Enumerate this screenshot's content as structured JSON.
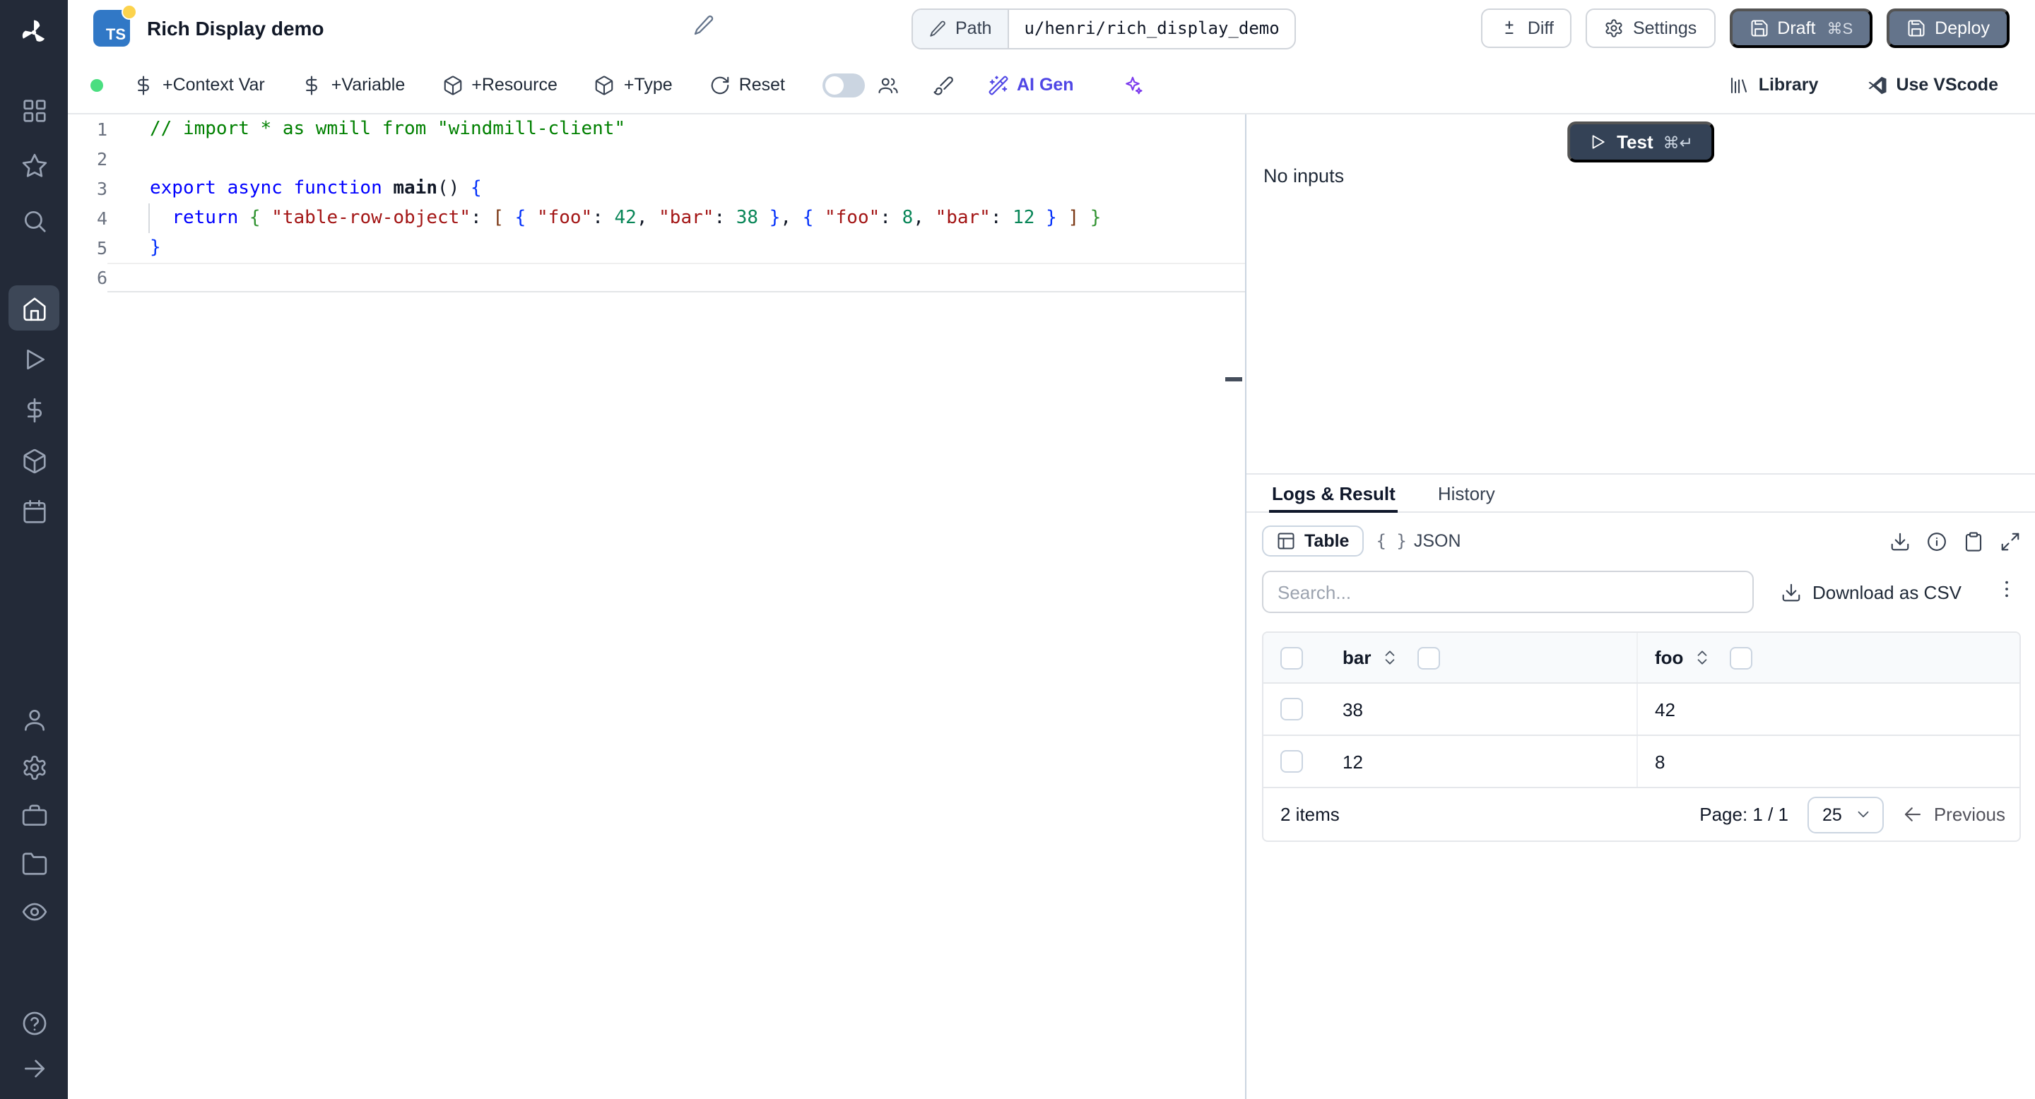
{
  "colors": {
    "sidebar_bg": "#232a38",
    "ts_blue": "#3178c6",
    "status_dot_green": "#4ade80",
    "ai_accent": "#4f46e5",
    "slate_button": "#64748b",
    "test_button": "#344256"
  },
  "sidebar": {
    "top": [
      {
        "name": "apps",
        "icon": "grid"
      },
      {
        "name": "favorites",
        "icon": "star"
      },
      {
        "name": "search",
        "icon": "search"
      }
    ],
    "nav": [
      {
        "name": "home",
        "icon": "home",
        "active": true
      },
      {
        "name": "runs",
        "icon": "play"
      },
      {
        "name": "variables",
        "icon": "dollar"
      },
      {
        "name": "resources",
        "icon": "cube"
      },
      {
        "name": "schedules",
        "icon": "calendar"
      }
    ],
    "lower": [
      {
        "name": "workers",
        "icon": "user"
      },
      {
        "name": "settings",
        "icon": "gear"
      },
      {
        "name": "jobs",
        "icon": "briefcase"
      },
      {
        "name": "folders",
        "icon": "folder"
      },
      {
        "name": "audit-logs",
        "icon": "eye"
      }
    ],
    "bottom": [
      {
        "name": "help",
        "icon": "help"
      },
      {
        "name": "expand-sidebar",
        "icon": "arrow-right"
      }
    ]
  },
  "header": {
    "logo_text": "TS",
    "title": "Rich Display demo",
    "path_label": "Path",
    "path_value": "u/henri/rich_display_demo",
    "diff_label": "Diff",
    "settings_label": "Settings",
    "draft_label": "Draft",
    "draft_shortcut": "⌘S",
    "deploy_label": "Deploy"
  },
  "toolbar": {
    "context_var": "+Context Var",
    "variable": "+Variable",
    "resource": "+Resource",
    "type": "+Type",
    "reset": "Reset",
    "ai_gen": "AI Gen",
    "library": "Library",
    "vscode": "Use VScode"
  },
  "editor": {
    "lines": [
      {
        "num": "1",
        "tokens": [
          [
            "// import * as wmill from \"windmill-client\"",
            "cm"
          ]
        ]
      },
      {
        "num": "2",
        "tokens": []
      },
      {
        "num": "3",
        "tokens": [
          [
            "export async function ",
            "kw"
          ],
          [
            "main",
            "fn"
          ],
          [
            "() ",
            "p"
          ],
          [
            "{",
            "b1"
          ]
        ]
      },
      {
        "num": "4",
        "guide": true,
        "tokens": [
          [
            "  ",
            "p"
          ],
          [
            "return",
            "kw"
          ],
          [
            " ",
            "p"
          ],
          [
            "{",
            "b2"
          ],
          [
            " ",
            "p"
          ],
          [
            "\"table-row-object\"",
            "str"
          ],
          [
            ": ",
            "p"
          ],
          [
            "[",
            "b3"
          ],
          [
            " ",
            "p"
          ],
          [
            "{",
            "b1"
          ],
          [
            " ",
            "p"
          ],
          [
            "\"foo\"",
            "str"
          ],
          [
            ": ",
            "p"
          ],
          [
            "42",
            "num"
          ],
          [
            ", ",
            "p"
          ],
          [
            "\"bar\"",
            "str"
          ],
          [
            ": ",
            "p"
          ],
          [
            "38",
            "num"
          ],
          [
            " ",
            "p"
          ],
          [
            "}",
            "b1"
          ],
          [
            ", ",
            "p"
          ],
          [
            "{",
            "b1"
          ],
          [
            " ",
            "p"
          ],
          [
            "\"foo\"",
            "str"
          ],
          [
            ": ",
            "p"
          ],
          [
            "8",
            "num"
          ],
          [
            ", ",
            "p"
          ],
          [
            "\"bar\"",
            "str"
          ],
          [
            ": ",
            "p"
          ],
          [
            "12",
            "num"
          ],
          [
            " ",
            "p"
          ],
          [
            "}",
            "b1"
          ],
          [
            " ",
            "p"
          ],
          [
            "]",
            "b3"
          ],
          [
            " ",
            "p"
          ],
          [
            "}",
            "b2"
          ]
        ]
      },
      {
        "num": "5",
        "tokens": [
          [
            "}",
            "b1"
          ]
        ]
      },
      {
        "num": "6",
        "tokens": [],
        "current": true
      }
    ]
  },
  "run_panel": {
    "test_label": "Test",
    "test_shortcut": "⌘↵",
    "no_inputs": "No inputs"
  },
  "result_panel": {
    "tabs": [
      {
        "label": "Logs & Result",
        "active": true
      },
      {
        "label": "History"
      }
    ],
    "views": [
      {
        "label": "Table",
        "active": true
      },
      {
        "label": "JSON"
      }
    ],
    "json_braces": "{ }",
    "search_placeholder": "Search...",
    "download_csv": "Download as CSV",
    "table": {
      "columns": [
        "bar",
        "foo"
      ],
      "rows": [
        [
          "38",
          "42"
        ],
        [
          "12",
          "8"
        ]
      ],
      "items_label": "2 items",
      "page_label": "Page: 1 / 1",
      "page_size": "25",
      "prev_label": "Previous"
    }
  },
  "icon_names": [
    "windmill-logo",
    "grid",
    "star",
    "search",
    "home",
    "play",
    "dollar",
    "cube",
    "calendar",
    "user",
    "gear",
    "briefcase",
    "folder",
    "eye",
    "help",
    "arrow-right",
    "pencil",
    "diff",
    "save",
    "rotate",
    "users",
    "brush",
    "wand",
    "sparkles",
    "library",
    "vscode",
    "table",
    "download",
    "info",
    "clipboard",
    "expand",
    "sort",
    "chevron-down",
    "kebab",
    "arrow-left"
  ]
}
